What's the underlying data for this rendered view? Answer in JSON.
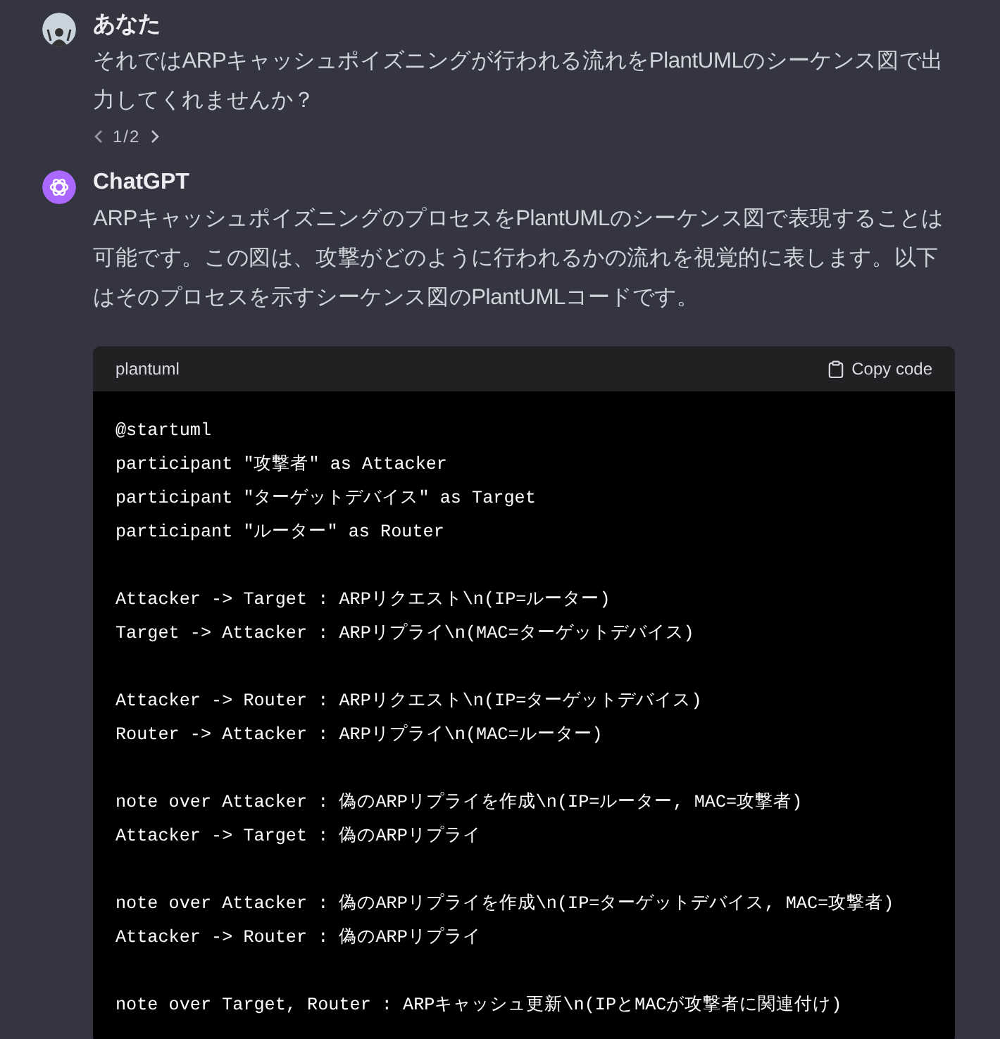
{
  "messages": [
    {
      "kind": "user",
      "author": "あなた",
      "text": "それではARPキャッシュポイズニングが行われる流れをPlantUMLのシーケンス図で出力してくれませんか？",
      "pager": "1/2"
    },
    {
      "kind": "assistant",
      "author": "ChatGPT",
      "text": "ARPキャッシュポイズニングのプロセスをPlantUMLのシーケンス図で表現することは可能です。この図は、攻撃がどのように行われるかの流れを視覚的に表します。以下はそのプロセスを示すシーケンス図のPlantUMLコードです。",
      "code": {
        "language": "plantuml",
        "copy_label": "Copy code",
        "blocks": [
          [
            "@startuml",
            "participant \"攻撃者\" as Attacker",
            "participant \"ターゲットデバイス\" as Target",
            "participant \"ルーター\" as Router"
          ],
          [
            "Attacker -> Target : ARPリクエスト\\n(IP=ルーター)",
            "Target -> Attacker : ARPリプライ\\n(MAC=ターゲットデバイス)"
          ],
          [
            "Attacker -> Router : ARPリクエスト\\n(IP=ターゲットデバイス)",
            "Router -> Attacker : ARPリプライ\\n(MAC=ルーター)"
          ],
          [
            "note over Attacker : 偽のARPリプライを作成\\n(IP=ルーター, MAC=攻撃者)",
            "Attacker -> Target : 偽のARPリプライ"
          ],
          [
            "note over Attacker : 偽のARPリプライを作成\\n(IP=ターゲットデバイス, MAC=攻撃者)",
            "Attacker -> Router : 偽のARPリプライ"
          ],
          [
            "note over Target, Router : ARPキャッシュ更新\\n(IPとMACが攻撃者に関連付け)"
          ]
        ]
      }
    }
  ]
}
